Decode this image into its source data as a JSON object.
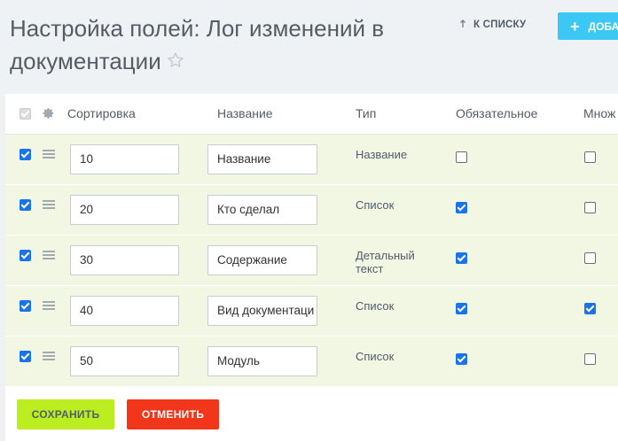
{
  "page": {
    "title": "Настройка полей: Лог изменений в документации",
    "back_link": "К СПИСКУ",
    "add_button": "ДОБАВИТЬ"
  },
  "table": {
    "headers": {
      "sort": "Сортировка",
      "name": "Название",
      "type": "Тип",
      "required": "Обязательное",
      "multiple": "Множ"
    },
    "rows": [
      {
        "selected": true,
        "sort": "10",
        "name": "Название",
        "type": "Название",
        "required": false,
        "multiple": false
      },
      {
        "selected": true,
        "sort": "20",
        "name": "Кто сделал",
        "type": "Список",
        "required": true,
        "multiple": false
      },
      {
        "selected": true,
        "sort": "30",
        "name": "Содержание",
        "type": "Детальный текст",
        "required": true,
        "multiple": false
      },
      {
        "selected": true,
        "sort": "40",
        "name": "Вид документаци",
        "type": "Список",
        "required": true,
        "multiple": true
      },
      {
        "selected": true,
        "sort": "50",
        "name": "Модуль",
        "type": "Список",
        "required": true,
        "multiple": false
      }
    ]
  },
  "footer": {
    "save": "СОХРАНИТЬ",
    "cancel": "ОТМЕНИТЬ"
  },
  "colors": {
    "accent": "#3bc8f5",
    "save": "#bbed21",
    "cancel": "#f1361b",
    "row_bg": "#f1f7e3"
  }
}
